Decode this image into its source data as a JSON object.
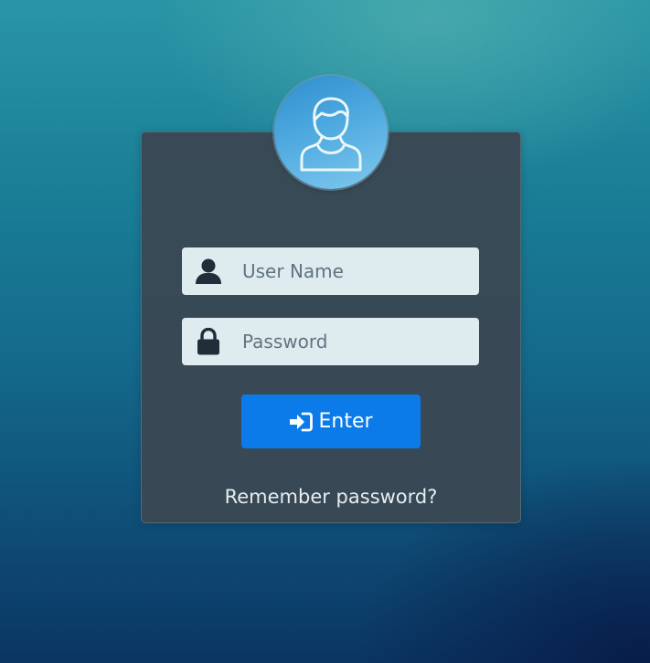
{
  "login": {
    "avatar_icon": "user-avatar-icon",
    "username": {
      "placeholder": "User Name",
      "value": "",
      "icon": "user-icon"
    },
    "password": {
      "placeholder": "Password",
      "value": "",
      "icon": "lock-icon"
    },
    "enter_button": {
      "label": "Enter",
      "icon": "sign-in-icon"
    },
    "remember_link": "Remember password?"
  },
  "colors": {
    "card_background": "#3a4854",
    "input_background": "#deebef",
    "button_primary": "#0b7bea",
    "avatar_blue": "#4ea9df",
    "background_top": "#2a95a6",
    "background_bottom": "#0b3563"
  }
}
